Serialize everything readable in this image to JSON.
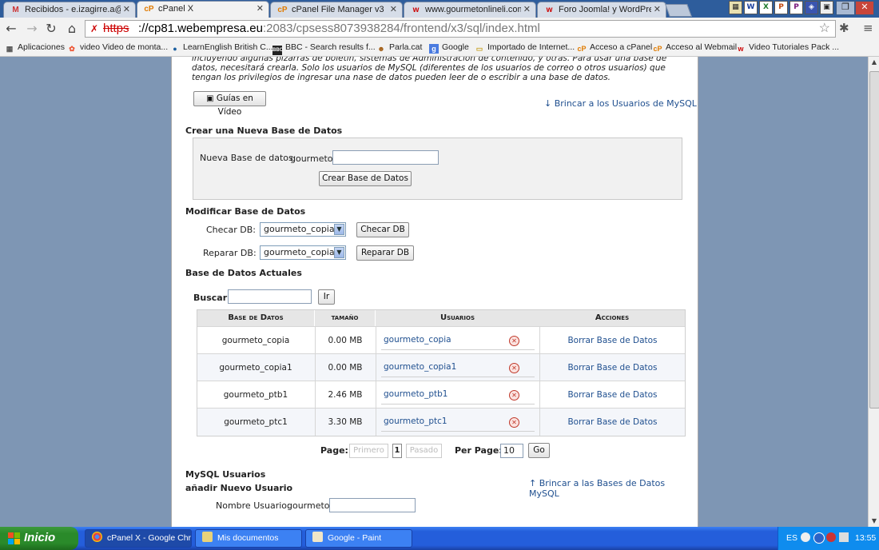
{
  "browser": {
    "tabs": [
      {
        "label": "Recibidos - e.izagirre.a@gm",
        "icon": "M",
        "active": false
      },
      {
        "label": "cPanel X",
        "icon": "cP",
        "active": true
      },
      {
        "label": "cPanel File Manager v3",
        "icon": "cP",
        "active": false
      },
      {
        "label": "www.gourmetonlineli.com",
        "icon": "w",
        "active": false
      },
      {
        "label": "Foro Joomla! y WordPress :",
        "icon": "w",
        "active": false
      }
    ],
    "url_scheme": "https",
    "url_host": "://cp81.webempresa.eu",
    "url_rest": ":2083/cpsess8073938284/frontend/x3/sql/index.html",
    "bookmarks": [
      "Aplicaciones",
      "video Video de monta...",
      "LearnEnglish  British C...",
      "BBC - Search results f...",
      "Parla.cat",
      "Google",
      "Importado de Internet...",
      "Acceso a cPanel",
      "Acceso al Webmail",
      "Video Tutoriales Pack ..."
    ]
  },
  "intro": {
    "text": "incluyendo algunas pizarras de boletín, sistemas de Administración de contenido, y otras. Para usar una base de datos, necesitará crearla. Solo los usuarios de MySQL (diferentes de los usuarios de correo o otros usuarios) que tengan los privilegios de ingresar una nase de datos pueden leer de o escribir a una base de datos."
  },
  "video_button": "Guías en Vídeo",
  "jump_users_link": "↓ Brincar a los Usuarios de MySQL",
  "create_db": {
    "title": "Crear una Nueva Base de Datos",
    "label": "Nueva Base de datos:",
    "prefix": "gourmeto_",
    "value": "",
    "button": "Crear Base de Datos"
  },
  "modify_db": {
    "title": "Modificar Base de Datos",
    "check_label": "Checar DB:",
    "check_value": "gourmeto_copia",
    "check_button": "Checar DB",
    "repair_label": "Reparar DB:",
    "repair_value": "gourmeto_copia",
    "repair_button": "Reparar DB"
  },
  "current_db": {
    "title": "Base de Datos Actuales",
    "search_label": "Buscar",
    "search_value": "",
    "search_button": "Ir"
  },
  "table": {
    "headers": [
      "Base de Datos",
      "tamaño",
      "Usuarios",
      "Acciones"
    ],
    "rows": [
      {
        "name": "gourmeto_copia",
        "size": "0.00 MB",
        "user": "gourmeto_copia",
        "action": "Borrar Base de Datos"
      },
      {
        "name": "gourmeto_copia1",
        "size": "0.00 MB",
        "user": "gourmeto_copia1",
        "action": "Borrar Base de Datos"
      },
      {
        "name": "gourmeto_ptb1",
        "size": "2.46 MB",
        "user": "gourmeto_ptb1",
        "action": "Borrar Base de Datos"
      },
      {
        "name": "gourmeto_ptc1",
        "size": "3.30 MB",
        "user": "gourmeto_ptc1",
        "action": "Borrar Base de Datos"
      }
    ]
  },
  "pagination": {
    "page_label": "Page:",
    "first": "Primero",
    "current": "1",
    "last": "Pasado",
    "per_page_label": "Per Page:",
    "per_page_value": "10",
    "go": "Go"
  },
  "mysql_users": {
    "title": "MySQL Usuarios",
    "subtitle": "añadir Nuevo Usuario",
    "jump_db_link": "↑ Brincar a las Bases de Datos MySQL",
    "user_label": "Nombre Usuario:",
    "user_prefix": "gourmeto_",
    "user_value": ""
  },
  "taskbar": {
    "start": "Inicio",
    "tasks": [
      {
        "label": "cPanel X - Google Chr...",
        "active": true
      },
      {
        "label": "Mis documentos",
        "active": false
      },
      {
        "label": "Google - Paint",
        "active": false
      }
    ],
    "lang": "ES",
    "clock": "13:55"
  },
  "colors": {
    "link": "#1f4f8f",
    "taskbar": "#245edb",
    "start": "#2a8a2a"
  }
}
